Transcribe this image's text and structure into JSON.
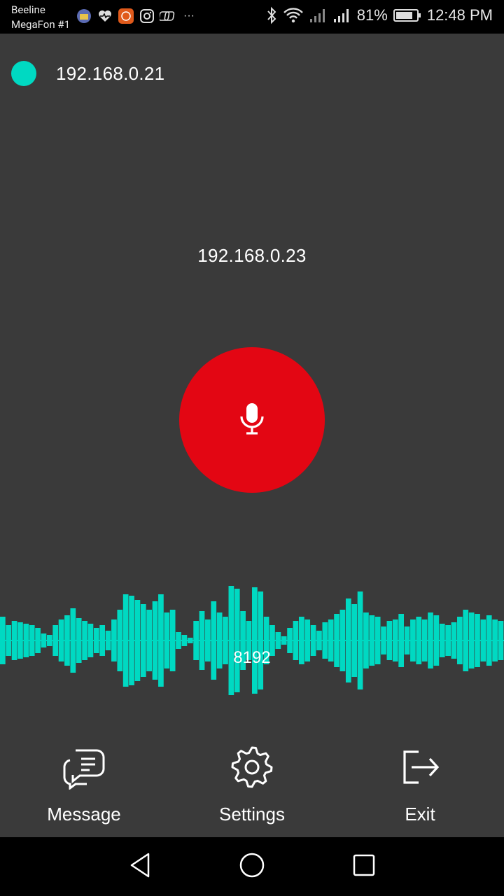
{
  "status_bar": {
    "carrier_1": "Beeline",
    "carrier_2": "MegaFon #1",
    "battery": "81%",
    "time": "12:48 PM",
    "more": "···"
  },
  "connection": {
    "local_ip": "192.168.0.21",
    "dot_color": "#00d9c2"
  },
  "peer": {
    "ip": "192.168.0.23"
  },
  "mic": {
    "color": "#e30613"
  },
  "waveform": {
    "value": "8192",
    "color": "#00d9c2"
  },
  "bottom_nav": {
    "items": [
      {
        "label": "Message",
        "icon": "message-icon"
      },
      {
        "label": "Settings",
        "icon": "gear-icon"
      },
      {
        "label": "Exit",
        "icon": "exit-icon"
      }
    ]
  },
  "colors": {
    "background": "#3a3a3a",
    "accent": "#00d9c2",
    "record": "#e30613"
  }
}
